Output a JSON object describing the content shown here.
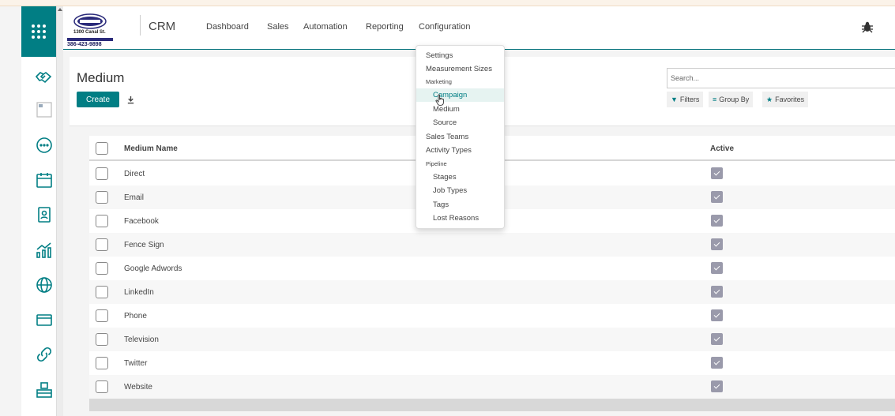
{
  "app": {
    "brand": "CRM",
    "logo": {
      "line1": "1300 Canal St.",
      "line2": "386-423-9898"
    }
  },
  "topnav": {
    "items": [
      "Dashboard",
      "Sales",
      "Automation",
      "Reporting",
      "Configuration"
    ]
  },
  "sidebar": {
    "icons": [
      "handshake-icon",
      "broken-image-icon",
      "chat-icon",
      "calendar-icon",
      "contacts-icon",
      "chart-icon",
      "globe-icon",
      "credit-card-icon",
      "link-icon",
      "inventory-icon"
    ]
  },
  "control": {
    "title": "Medium",
    "create_label": "Create",
    "search_placeholder": "Search...",
    "filters_label": "Filters",
    "groupby_label": "Group By",
    "favorites_label": "Favorites"
  },
  "list": {
    "columns": [
      "Medium Name",
      "Active"
    ],
    "rows": [
      {
        "name": "Direct",
        "active": true
      },
      {
        "name": "Email",
        "active": true
      },
      {
        "name": "Facebook",
        "active": true
      },
      {
        "name": "Fence Sign",
        "active": true
      },
      {
        "name": "Google Adwords",
        "active": true
      },
      {
        "name": "LinkedIn",
        "active": true
      },
      {
        "name": "Phone",
        "active": true
      },
      {
        "name": "Television",
        "active": true
      },
      {
        "name": "Twitter",
        "active": true
      },
      {
        "name": "Website",
        "active": true
      }
    ]
  },
  "config_menu": {
    "settings": "Settings",
    "measurement_sizes": "Measurement Sizes",
    "marketing_header": "Marketing",
    "campaign": "Campaign",
    "medium": "Medium",
    "source": "Source",
    "sales_teams": "Sales Teams",
    "activity_types": "Activity Types",
    "pipeline_header": "Pipeline",
    "stages": "Stages",
    "job_types": "Job Types",
    "tags": "Tags",
    "lost_reasons": "Lost Reasons"
  },
  "colors": {
    "accent": "#017e84",
    "active_checkbox": "#9a9aab",
    "hover_bg": "#e6f3f1"
  }
}
